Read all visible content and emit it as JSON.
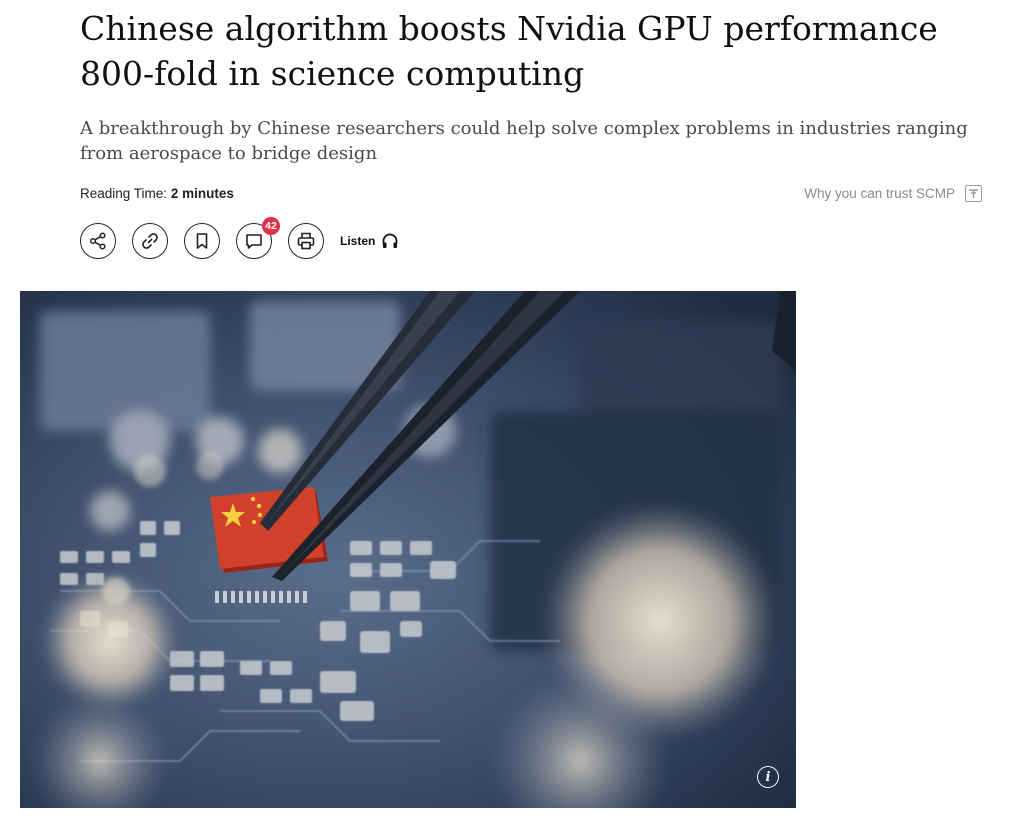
{
  "article": {
    "headline": "Chinese algorithm boosts Nvidia GPU performance 800-fold in science computing",
    "dek": "A breakthrough by Chinese researchers could help solve complex problems in industries ranging from aerospace to bridge design",
    "reading_time_label": "Reading Time:",
    "reading_time_value": "2 minutes",
    "trust_link": "Why you can trust SCMP"
  },
  "toolbar": {
    "share_icon": "share-icon",
    "link_icon": "link-icon",
    "bookmark_icon": "bookmark-icon",
    "comment_icon": "comment-icon",
    "comment_count": "42",
    "print_icon": "print-icon",
    "listen_label": "Listen",
    "listen_icon": "headphones-icon"
  },
  "hero_image": {
    "info_label": "i"
  },
  "colors": {
    "badge": "#e0314a",
    "text_primary": "#111111",
    "text_secondary": "#4a4a4a",
    "muted": "#8a8a8a"
  }
}
